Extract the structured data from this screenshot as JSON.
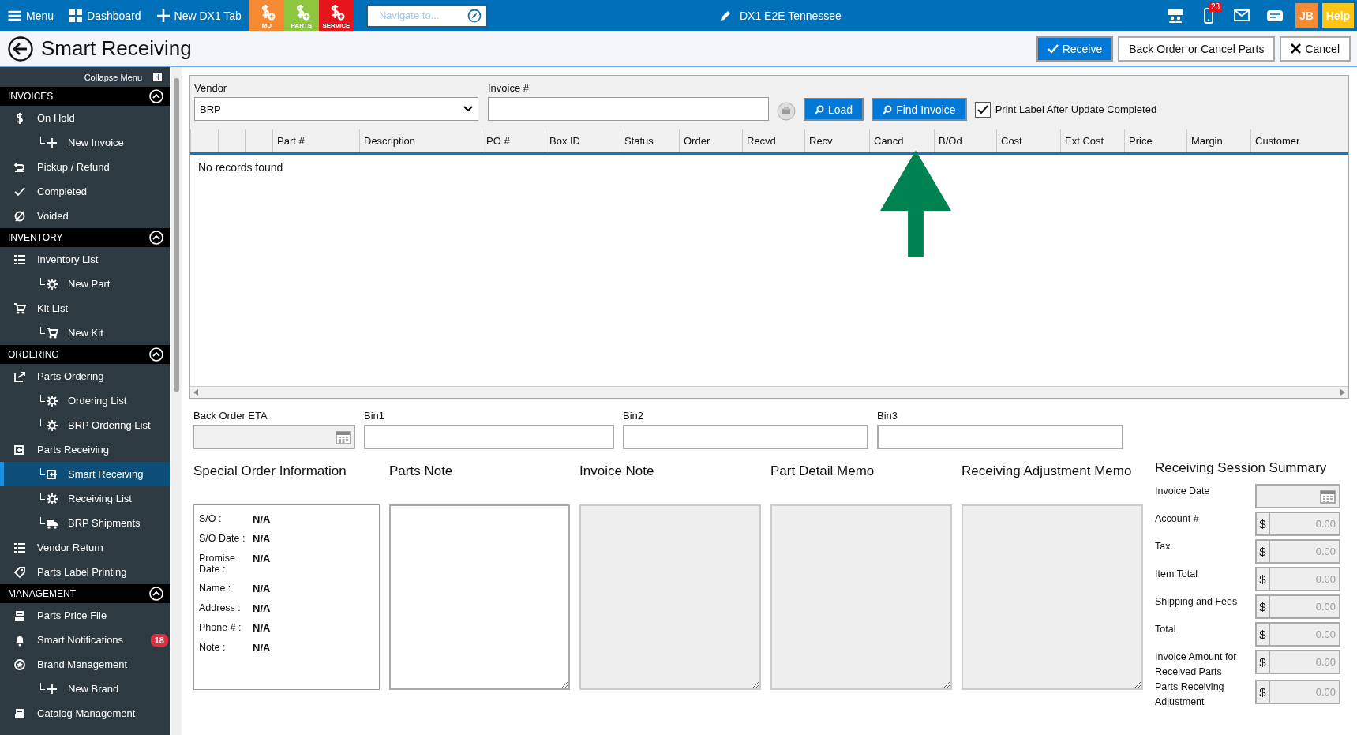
{
  "topbar": {
    "menu": "Menu",
    "dashboard": "Dashboard",
    "new_tab": "New DX1 Tab",
    "quick_buttons": [
      {
        "label": "MU",
        "color": "#f58a33"
      },
      {
        "label": "PARTS",
        "color": "#8dc63f"
      },
      {
        "label": "SERVICE",
        "color": "#e8141b"
      }
    ],
    "navigate": {
      "placeholder": "Navigate to..."
    },
    "location": "DX1 E2E Tennessee",
    "phone_badge": "23",
    "user": "JB",
    "help": "Help"
  },
  "header": {
    "title": "Smart Receiving",
    "buttons": [
      {
        "label": "Receive",
        "kind": "primary"
      },
      {
        "label": "Back Order or Cancel Parts",
        "kind": "plain"
      },
      {
        "label": "Cancel",
        "kind": "cancel"
      }
    ]
  },
  "sidebar": {
    "collapse": "Collapse Menu",
    "sections": [
      {
        "title": "INVOICES",
        "expanded": true,
        "items": [
          {
            "label": "On Hold",
            "selected": false,
            "children": [
              {
                "label": "New Invoice",
                "selected": false
              }
            ]
          },
          {
            "label": "Pickup / Refund",
            "selected": false
          },
          {
            "label": "Completed",
            "selected": false
          },
          {
            "label": "Voided",
            "selected": false
          }
        ]
      },
      {
        "title": "INVENTORY",
        "expanded": true,
        "items": [
          {
            "label": "Inventory List",
            "selected": false,
            "children": [
              {
                "label": "New Part",
                "selected": false
              }
            ]
          },
          {
            "label": "Kit List",
            "selected": false,
            "children": [
              {
                "label": "New Kit",
                "selected": false
              }
            ]
          }
        ]
      },
      {
        "title": "ORDERING",
        "expanded": true,
        "items": [
          {
            "label": "Parts Ordering",
            "selected": false,
            "children": [
              {
                "label": "Ordering List",
                "selected": false
              },
              {
                "label": "BRP Ordering List",
                "selected": false
              }
            ]
          },
          {
            "label": "Parts Receiving",
            "selected": false,
            "children": [
              {
                "label": "Smart Receiving",
                "selected": true
              },
              {
                "label": "Receiving List",
                "selected": false
              },
              {
                "label": "BRP Shipments",
                "selected": false
              }
            ]
          },
          {
            "label": "Vendor Return",
            "selected": false
          },
          {
            "label": "Parts Label Printing",
            "selected": false
          }
        ]
      },
      {
        "title": "MANAGEMENT",
        "expanded": true,
        "items": [
          {
            "label": "Parts Price File",
            "selected": false
          },
          {
            "label": "Smart Notifications",
            "selected": false,
            "badge": "18"
          },
          {
            "label": "Brand Management",
            "selected": false,
            "children": [
              {
                "label": "New Brand",
                "selected": false
              }
            ]
          },
          {
            "label": "Catalog Management",
            "selected": false
          }
        ]
      }
    ]
  },
  "form": {
    "vendor": {
      "label": "Vendor",
      "value": "BRP"
    },
    "invoice": {
      "label": "Invoice #"
    },
    "buttons": [
      {
        "label": "Load"
      },
      {
        "label": "Find Invoice"
      }
    ],
    "print_label": {
      "label": "Print Label After Update Completed",
      "checked": true
    }
  },
  "table": {
    "columns": [
      "Part #",
      "Description",
      "PO #",
      "Box ID",
      "Status",
      "Order",
      "Recvd",
      "Recv",
      "Cancd",
      "B/Od",
      "Cost",
      "Ext Cost",
      "Price",
      "Margin",
      "Customer"
    ],
    "empty_message": "No records found"
  },
  "bins": [
    {
      "label": "Back Order ETA",
      "kind": "date"
    },
    {
      "label": "Bin1",
      "kind": "text"
    },
    {
      "label": "Bin2",
      "kind": "text"
    },
    {
      "label": "Bin3",
      "kind": "text"
    }
  ],
  "special_order": {
    "title": "Special Order Information",
    "rows": [
      {
        "label": "S/O :",
        "value": "N/A"
      },
      {
        "label": "S/O Date :",
        "value": "N/A"
      },
      {
        "label": "Promise Date :",
        "value": "N/A"
      },
      {
        "label": "Name :",
        "value": "N/A"
      },
      {
        "label": "Address :",
        "value": "N/A"
      },
      {
        "label": "Phone # :",
        "value": "N/A"
      },
      {
        "label": "Note :",
        "value": "N/A"
      }
    ]
  },
  "notes": [
    {
      "title": "Parts Note",
      "disabled": false
    },
    {
      "title": "Invoice Note",
      "disabled": true
    },
    {
      "title": "Part Detail Memo",
      "disabled": true
    },
    {
      "title": "Receiving Adjustment Memo",
      "disabled": true
    }
  ],
  "summary": {
    "title": "Receiving Session Summary",
    "rows": [
      {
        "label": "Invoice Date",
        "kind": "date"
      },
      {
        "label": "Account #",
        "kind": "money",
        "currency": "$",
        "value": "0.00"
      },
      {
        "label": "Tax",
        "kind": "money",
        "currency": "$",
        "value": "0.00"
      },
      {
        "label": "Item Total",
        "kind": "money",
        "currency": "$",
        "value": "0.00"
      },
      {
        "label": "Shipping and Fees",
        "kind": "money",
        "currency": "$",
        "value": "0.00"
      },
      {
        "label": "Total",
        "kind": "money",
        "currency": "$",
        "value": "0.00"
      },
      {
        "label": "Invoice Amount for Received Parts",
        "kind": "money",
        "currency": "$",
        "value": "0.00"
      },
      {
        "label": "Parts Receiving Adjustment",
        "kind": "money",
        "currency": "$",
        "value": "0.00"
      }
    ]
  }
}
